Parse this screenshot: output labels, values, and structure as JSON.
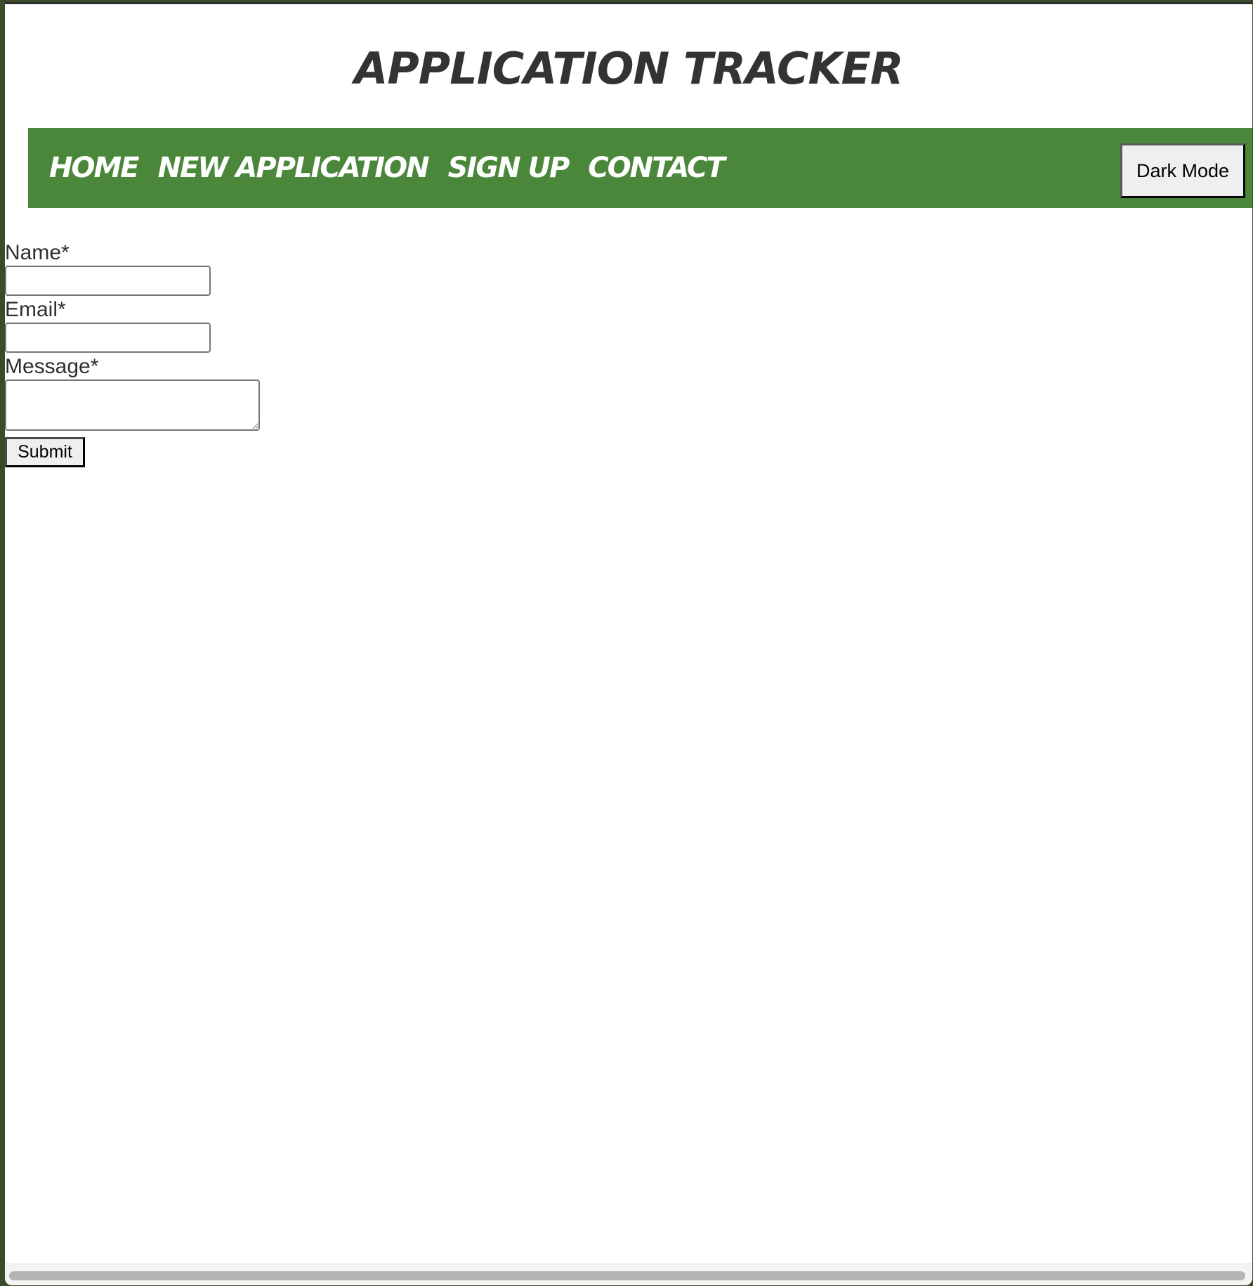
{
  "header": {
    "title": "Application Tracker"
  },
  "nav": {
    "links": [
      {
        "label": "Home"
      },
      {
        "label": "New Application"
      },
      {
        "label": "Sign Up"
      },
      {
        "label": "Contact"
      }
    ],
    "dark_mode_label": "Dark Mode"
  },
  "form": {
    "name_label": "Name*",
    "name_value": "",
    "email_label": "Email*",
    "email_value": "",
    "message_label": "Message*",
    "message_value": "",
    "submit_label": "Submit"
  },
  "colors": {
    "nav_background": "#4a873a",
    "title_text": "#333333",
    "nav_text": "#ffffff"
  }
}
